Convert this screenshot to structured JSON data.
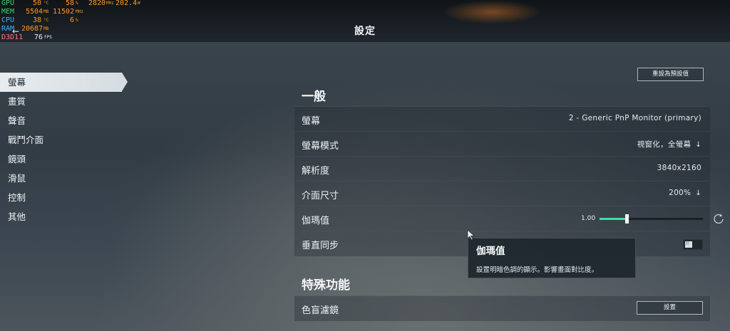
{
  "header": {
    "title": "設定",
    "back_arrow": "←"
  },
  "overlay": {
    "rows": [
      {
        "label": "GPU",
        "label_color": "#3fd06a",
        "v1": "50",
        "u1": "°C",
        "v2": "58",
        "u2": "%",
        "v3": "2820",
        "u3": "MHz",
        "v4": "202.4",
        "u4": "W"
      },
      {
        "label": "MEM",
        "label_color": "#3fd06a",
        "v1": "5504",
        "u1": "MB",
        "v2": "11502",
        "u2": "MHz",
        "v3": "",
        "u3": "",
        "v4": "",
        "u4": ""
      },
      {
        "label": "CPU",
        "label_color": "#3fb0ff",
        "v1": "38",
        "u1": "°C",
        "v2": "6",
        "u2": "%",
        "v3": "",
        "u3": "",
        "v4": "",
        "u4": ""
      },
      {
        "label": "RAM",
        "label_color": "#3fb0ff",
        "v1": "20687",
        "u1": "MB",
        "v2": "",
        "u2": "",
        "v3": "",
        "u3": "",
        "v4": "",
        "u4": ""
      },
      {
        "label": "D3D11",
        "label_color": "#ff7a7a",
        "v1": "76",
        "u1": "FPS",
        "v2": "",
        "u2": "",
        "v3": "",
        "u3": "",
        "v4": "",
        "u4": ""
      }
    ]
  },
  "sidebar": {
    "items": [
      {
        "label": "螢幕",
        "active": true
      },
      {
        "label": "畫質",
        "active": false
      },
      {
        "label": "聲音",
        "active": false
      },
      {
        "label": "戰鬥介面",
        "active": false
      },
      {
        "label": "鏡頭",
        "active": false
      },
      {
        "label": "滑鼠",
        "active": false
      },
      {
        "label": "控制",
        "active": false
      },
      {
        "label": "其他",
        "active": false
      }
    ]
  },
  "main": {
    "reset_label": "重設為預設值",
    "general_title": "一般",
    "rows": {
      "monitor": {
        "label": "螢幕",
        "value": "2 - Generic PnP Monitor (primary)"
      },
      "screen_mode": {
        "label": "螢幕模式",
        "value": "視窗化，全螢幕",
        "arrow": "↓"
      },
      "resolution": {
        "label": "解析度",
        "value": "3840x2160"
      },
      "ui_size": {
        "label": "介面尺寸",
        "value": "200%",
        "arrow": "↓"
      },
      "gamma": {
        "label": "伽瑪值",
        "value_text": "1.00",
        "fraction": 0.26
      },
      "vsync": {
        "label": "垂直同步",
        "on": false,
        "toggle_text": "II"
      }
    },
    "special_title": "特殊功能",
    "colorblind": {
      "label": "色盲濾鏡",
      "button": "設置"
    }
  },
  "tooltip": {
    "title": "伽瑪值",
    "desc": "設置明暗色調的顯示。影響畫面對比度。"
  },
  "colors": {
    "accent": "#3fe0a0",
    "overlay_value": "#ff9a1e"
  }
}
